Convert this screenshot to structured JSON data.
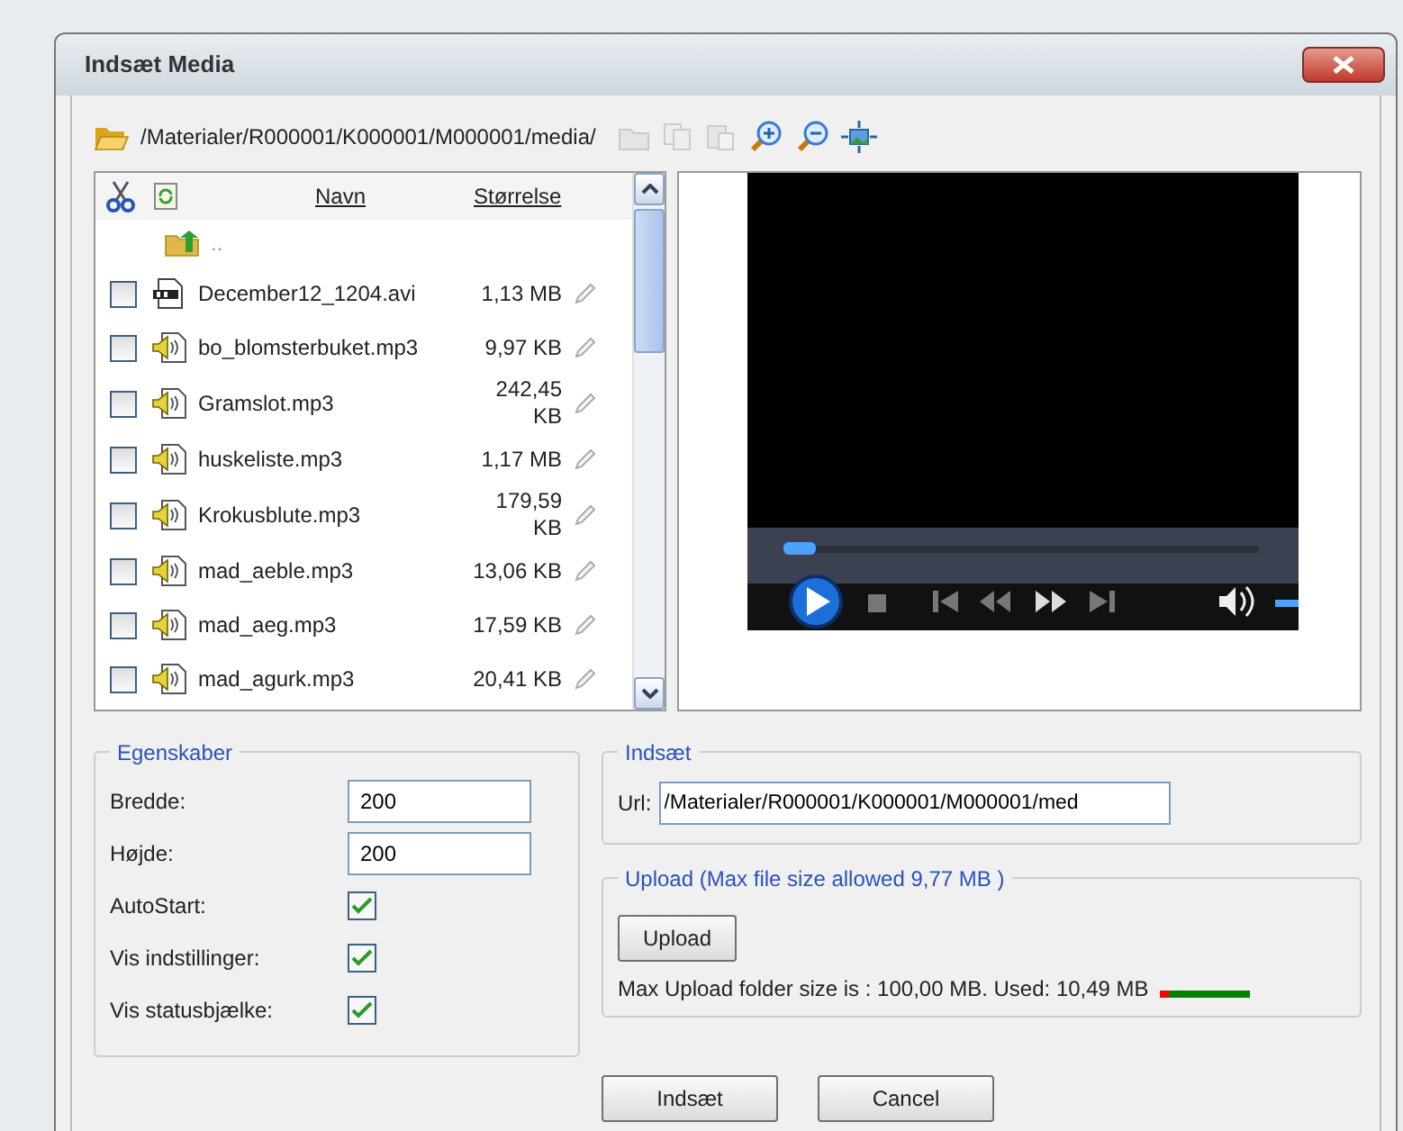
{
  "window": {
    "title": "Indsæt Media"
  },
  "toolbar": {
    "path": "/Materialer/R000001/K000001/M000001/media/"
  },
  "file_list": {
    "columns": [
      "Navn",
      "Størrelse"
    ],
    "parent": "..",
    "files": [
      {
        "kind": "video",
        "name": "December12_1204.avi",
        "size": "1,13 MB",
        "checked": false
      },
      {
        "kind": "audio",
        "name": "bo_blomsterbuket.mp3",
        "size": "9,97 KB",
        "checked": false
      },
      {
        "kind": "audio",
        "name": "Gramslot.mp3",
        "size": "242,45 KB",
        "checked": false
      },
      {
        "kind": "audio",
        "name": "huskeliste.mp3",
        "size": "1,17 MB",
        "checked": false
      },
      {
        "kind": "audio",
        "name": "Krokusblute.mp3",
        "size": "179,59 KB",
        "checked": false
      },
      {
        "kind": "audio",
        "name": "mad_aeble.mp3",
        "size": "13,06 KB",
        "checked": false
      },
      {
        "kind": "audio",
        "name": "mad_aeg.mp3",
        "size": "17,59 KB",
        "checked": false
      },
      {
        "kind": "audio",
        "name": "mad_agurk.mp3",
        "size": "20,41 KB",
        "checked": false
      }
    ]
  },
  "properties": {
    "legend": "Egenskaber",
    "fields": [
      {
        "kind": "text",
        "label": "Bredde:",
        "value": "200"
      },
      {
        "kind": "text",
        "label": "Højde:",
        "value": "200"
      },
      {
        "kind": "checkbox",
        "label": "AutoStart:",
        "checked": true
      },
      {
        "kind": "checkbox",
        "label": "Vis indstillinger:",
        "checked": true
      },
      {
        "kind": "checkbox",
        "label": "Vis statusbjælke:",
        "checked": true
      }
    ]
  },
  "insert": {
    "legend": "Indsæt",
    "url_label": "Url:",
    "url": "/Materialer/R000001/K000001/M000001/med"
  },
  "upload": {
    "legend": "Upload (Max file size allowed 9,77 MB )",
    "button": "Upload",
    "usage": "Max Upload folder size is : 100,00 MB. Used: 10,49 MB",
    "level": 0.1
  },
  "buttons": [
    "Indsæt",
    "Cancel"
  ]
}
